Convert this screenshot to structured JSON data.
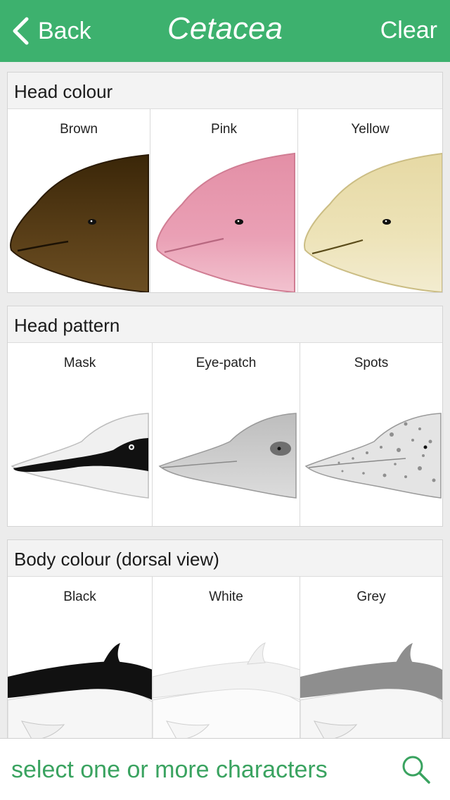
{
  "nav": {
    "back_label": "Back",
    "title": "Cetacea",
    "clear_label": "Clear",
    "color": "#3db16e"
  },
  "sections": [
    {
      "title": "Head colour",
      "options": [
        {
          "label": "Brown",
          "color": "#4a3212"
        },
        {
          "label": "Pink",
          "color": "#e9a3b6"
        },
        {
          "label": "Yellow",
          "color": "#ece2b5"
        }
      ]
    },
    {
      "title": "Head pattern",
      "options": [
        {
          "label": "Mask"
        },
        {
          "label": "Eye-patch"
        },
        {
          "label": "Spots"
        }
      ]
    },
    {
      "title": "Body colour (dorsal view)",
      "options": [
        {
          "label": "Black",
          "color": "#111111"
        },
        {
          "label": "White",
          "color": "#f4f4f4"
        },
        {
          "label": "Grey",
          "color": "#8e8e8e"
        }
      ]
    }
  ],
  "footer": {
    "search_placeholder": "select one or more characters",
    "search_icon": "search-icon"
  }
}
